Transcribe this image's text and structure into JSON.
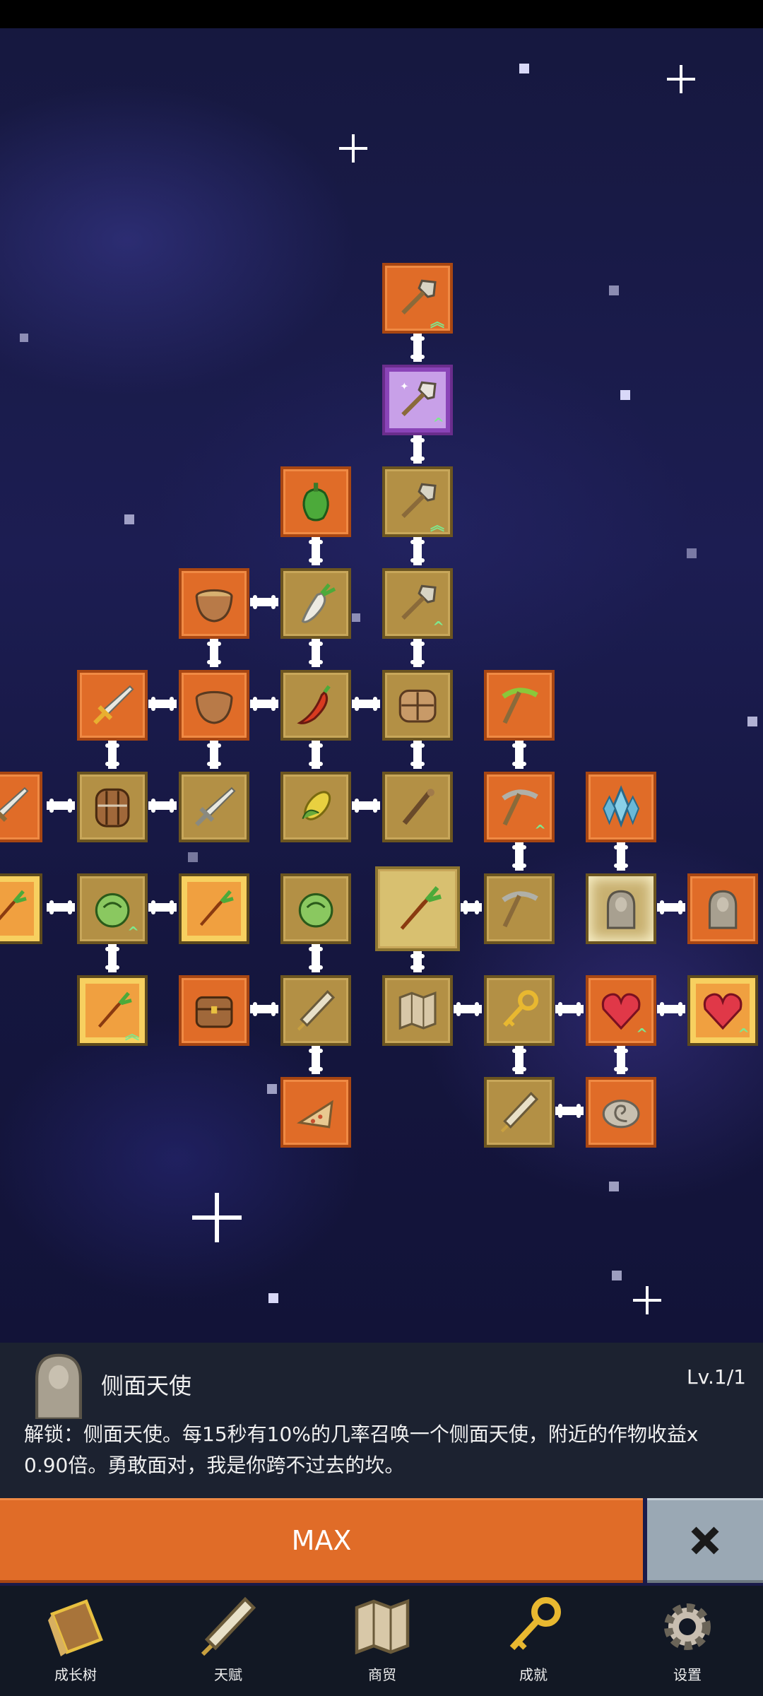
{
  "skill_tree": {
    "nodes": [
      {
        "id": "shovel-top",
        "icon": "shovel-icon",
        "ups": 2
      },
      {
        "id": "magic-shovel",
        "icon": "magic-shovel-icon",
        "ups": 1
      },
      {
        "id": "bell-pepper",
        "icon": "bell-pepper-icon",
        "ups": 0
      },
      {
        "id": "shovel-3",
        "icon": "shovel-icon",
        "ups": 2
      },
      {
        "id": "bowl-soup",
        "icon": "bowl-icon",
        "ups": 0
      },
      {
        "id": "radish",
        "icon": "radish-icon",
        "ups": 0
      },
      {
        "id": "shovel-4",
        "icon": "shovel-icon",
        "ups": 1
      },
      {
        "id": "sword-1",
        "icon": "sword-icon",
        "ups": 0
      },
      {
        "id": "bowl-2",
        "icon": "bowl-icon",
        "ups": 0
      },
      {
        "id": "chili",
        "icon": "chili-icon",
        "ups": 0
      },
      {
        "id": "bread",
        "icon": "bread-icon",
        "ups": 0
      },
      {
        "id": "pickaxe-1",
        "icon": "pickaxe-icon",
        "ups": 0
      },
      {
        "id": "sword-edge",
        "icon": "sword-icon",
        "ups": 0
      },
      {
        "id": "barrel",
        "icon": "barrel-icon",
        "ups": 0
      },
      {
        "id": "sword-2",
        "icon": "sword-icon",
        "ups": 0
      },
      {
        "id": "corn",
        "icon": "corn-icon",
        "ups": 0
      },
      {
        "id": "staff",
        "icon": "staff-icon",
        "ups": 0
      },
      {
        "id": "pickaxe-2",
        "icon": "pickaxe-icon",
        "ups": 1
      },
      {
        "id": "crystal",
        "icon": "crystal-icon",
        "ups": 0
      },
      {
        "id": "carrot-edge",
        "icon": "carrot-icon",
        "ups": 1
      },
      {
        "id": "cabbage-1",
        "icon": "cabbage-icon",
        "ups": 1
      },
      {
        "id": "carrot-framed",
        "icon": "carrot-icon",
        "ups": 0
      },
      {
        "id": "cabbage-2",
        "icon": "cabbage-icon",
        "ups": 0
      },
      {
        "id": "carrot-center",
        "icon": "carrot-icon",
        "ups": 0
      },
      {
        "id": "pickaxe-3",
        "icon": "pickaxe-icon",
        "ups": 0
      },
      {
        "id": "angel-selected",
        "icon": "angel-statue-icon",
        "ups": 0
      },
      {
        "id": "angel-2",
        "icon": "angel-statue-icon",
        "ups": 0
      },
      {
        "id": "carrot-3",
        "icon": "carrot-icon",
        "ups": 2
      },
      {
        "id": "chest",
        "icon": "chest-icon",
        "ups": 0
      },
      {
        "id": "scroll-1",
        "icon": "scroll-icon",
        "ups": 0
      },
      {
        "id": "map",
        "icon": "map-icon",
        "ups": 0
      },
      {
        "id": "key",
        "icon": "key-icon",
        "ups": 0
      },
      {
        "id": "heart-1",
        "icon": "heart-icon",
        "ups": 1
      },
      {
        "id": "heart-2",
        "icon": "heart-icon",
        "ups": 1
      },
      {
        "id": "pizza",
        "icon": "pizza-icon",
        "ups": 0
      },
      {
        "id": "scroll-2",
        "icon": "scroll-icon",
        "ups": 0
      },
      {
        "id": "fossil",
        "icon": "fossil-icon",
        "ups": 0
      }
    ]
  },
  "info": {
    "name": "侧面天使",
    "level": "Lv.1/1",
    "description": "解锁：侧面天使。每15秒有10%的几率召唤一个侧面天使，附近的作物收益x 0.90倍。勇敢面对，我是你跨不过去的坎。"
  },
  "actions": {
    "max_label": "MAX"
  },
  "nav": [
    {
      "label": "成长树",
      "icon": "book-icon"
    },
    {
      "label": "天赋",
      "icon": "scroll-icon"
    },
    {
      "label": "商贸",
      "icon": "map-icon"
    },
    {
      "label": "成就",
      "icon": "key-icon"
    },
    {
      "label": "设置",
      "icon": "gear-icon"
    }
  ],
  "colors": {
    "orange": "#e06c28",
    "gold": "#b39045",
    "panel": "#1c2230",
    "nav": "#121824"
  }
}
